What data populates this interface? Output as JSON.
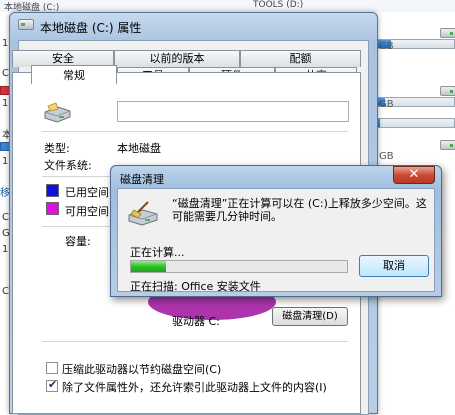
{
  "background": {
    "top_left": "本地磁盘 (C:)",
    "top_right": "TOOLS (D:)",
    "left_fragments": [
      "1",
      "C",
      "1",
      "本",
      "1",
      "移动",
      "C",
      "G",
      "1",
      "C"
    ],
    "gb_labels": [
      "GB",
      "GB",
      "GB"
    ]
  },
  "properties": {
    "title": "本地磁盘 (C:) 属性",
    "tabs_row1": [
      "安全",
      "以前的版本",
      "配额"
    ],
    "tabs_row2": [
      "常规",
      "工具",
      "硬件",
      "共享"
    ],
    "type_label": "类型:",
    "type_value": "本地磁盘",
    "fs_label": "文件系统:",
    "used_label": "已用空间",
    "free_label": "可用空间",
    "capacity_label": "容量:",
    "drive_label": "驱动器 C:",
    "cleanup_button": "磁盘清理(D)",
    "compress_label": "压缩此驱动器以节约磁盘空间(C)",
    "index_label": "除了文件属性外，还允许索引此驱动器上文件的内容(I)",
    "compress_checked": false,
    "index_checked": true,
    "used_color": "#1010e0",
    "free_color": "#e010e0"
  },
  "cleanup_dialog": {
    "title": "磁盘清理",
    "close_symbol": "✕",
    "message": "“磁盘清理”正在计算可以在 (C:)上释放多少空间。这可能需要几分钟时间。",
    "calculating": "正在计算...",
    "progress_fraction": 0.16,
    "cancel_label": "取消",
    "scanning": "正在扫描:   Office 安装文件"
  }
}
